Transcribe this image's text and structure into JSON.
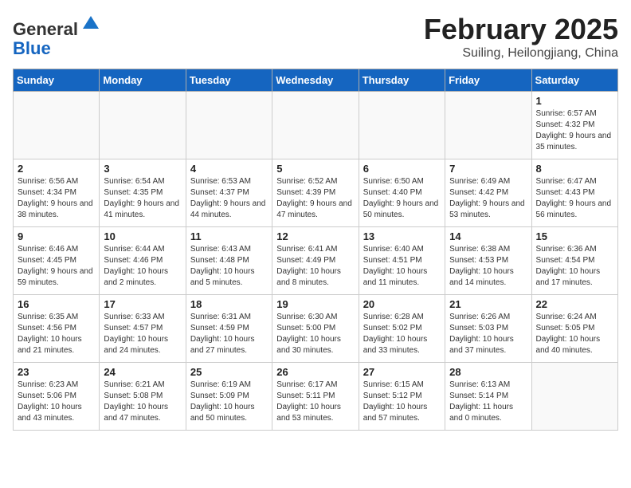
{
  "header": {
    "logo_general": "General",
    "logo_blue": "Blue",
    "month_title": "February 2025",
    "location": "Suiling, Heilongjiang, China"
  },
  "weekdays": [
    "Sunday",
    "Monday",
    "Tuesday",
    "Wednesday",
    "Thursday",
    "Friday",
    "Saturday"
  ],
  "weeks": [
    [
      {
        "day": "",
        "info": ""
      },
      {
        "day": "",
        "info": ""
      },
      {
        "day": "",
        "info": ""
      },
      {
        "day": "",
        "info": ""
      },
      {
        "day": "",
        "info": ""
      },
      {
        "day": "",
        "info": ""
      },
      {
        "day": "1",
        "info": "Sunrise: 6:57 AM\nSunset: 4:32 PM\nDaylight: 9 hours and 35 minutes."
      }
    ],
    [
      {
        "day": "2",
        "info": "Sunrise: 6:56 AM\nSunset: 4:34 PM\nDaylight: 9 hours and 38 minutes."
      },
      {
        "day": "3",
        "info": "Sunrise: 6:54 AM\nSunset: 4:35 PM\nDaylight: 9 hours and 41 minutes."
      },
      {
        "day": "4",
        "info": "Sunrise: 6:53 AM\nSunset: 4:37 PM\nDaylight: 9 hours and 44 minutes."
      },
      {
        "day": "5",
        "info": "Sunrise: 6:52 AM\nSunset: 4:39 PM\nDaylight: 9 hours and 47 minutes."
      },
      {
        "day": "6",
        "info": "Sunrise: 6:50 AM\nSunset: 4:40 PM\nDaylight: 9 hours and 50 minutes."
      },
      {
        "day": "7",
        "info": "Sunrise: 6:49 AM\nSunset: 4:42 PM\nDaylight: 9 hours and 53 minutes."
      },
      {
        "day": "8",
        "info": "Sunrise: 6:47 AM\nSunset: 4:43 PM\nDaylight: 9 hours and 56 minutes."
      }
    ],
    [
      {
        "day": "9",
        "info": "Sunrise: 6:46 AM\nSunset: 4:45 PM\nDaylight: 9 hours and 59 minutes."
      },
      {
        "day": "10",
        "info": "Sunrise: 6:44 AM\nSunset: 4:46 PM\nDaylight: 10 hours and 2 minutes."
      },
      {
        "day": "11",
        "info": "Sunrise: 6:43 AM\nSunset: 4:48 PM\nDaylight: 10 hours and 5 minutes."
      },
      {
        "day": "12",
        "info": "Sunrise: 6:41 AM\nSunset: 4:49 PM\nDaylight: 10 hours and 8 minutes."
      },
      {
        "day": "13",
        "info": "Sunrise: 6:40 AM\nSunset: 4:51 PM\nDaylight: 10 hours and 11 minutes."
      },
      {
        "day": "14",
        "info": "Sunrise: 6:38 AM\nSunset: 4:53 PM\nDaylight: 10 hours and 14 minutes."
      },
      {
        "day": "15",
        "info": "Sunrise: 6:36 AM\nSunset: 4:54 PM\nDaylight: 10 hours and 17 minutes."
      }
    ],
    [
      {
        "day": "16",
        "info": "Sunrise: 6:35 AM\nSunset: 4:56 PM\nDaylight: 10 hours and 21 minutes."
      },
      {
        "day": "17",
        "info": "Sunrise: 6:33 AM\nSunset: 4:57 PM\nDaylight: 10 hours and 24 minutes."
      },
      {
        "day": "18",
        "info": "Sunrise: 6:31 AM\nSunset: 4:59 PM\nDaylight: 10 hours and 27 minutes."
      },
      {
        "day": "19",
        "info": "Sunrise: 6:30 AM\nSunset: 5:00 PM\nDaylight: 10 hours and 30 minutes."
      },
      {
        "day": "20",
        "info": "Sunrise: 6:28 AM\nSunset: 5:02 PM\nDaylight: 10 hours and 33 minutes."
      },
      {
        "day": "21",
        "info": "Sunrise: 6:26 AM\nSunset: 5:03 PM\nDaylight: 10 hours and 37 minutes."
      },
      {
        "day": "22",
        "info": "Sunrise: 6:24 AM\nSunset: 5:05 PM\nDaylight: 10 hours and 40 minutes."
      }
    ],
    [
      {
        "day": "23",
        "info": "Sunrise: 6:23 AM\nSunset: 5:06 PM\nDaylight: 10 hours and 43 minutes."
      },
      {
        "day": "24",
        "info": "Sunrise: 6:21 AM\nSunset: 5:08 PM\nDaylight: 10 hours and 47 minutes."
      },
      {
        "day": "25",
        "info": "Sunrise: 6:19 AM\nSunset: 5:09 PM\nDaylight: 10 hours and 50 minutes."
      },
      {
        "day": "26",
        "info": "Sunrise: 6:17 AM\nSunset: 5:11 PM\nDaylight: 10 hours and 53 minutes."
      },
      {
        "day": "27",
        "info": "Sunrise: 6:15 AM\nSunset: 5:12 PM\nDaylight: 10 hours and 57 minutes."
      },
      {
        "day": "28",
        "info": "Sunrise: 6:13 AM\nSunset: 5:14 PM\nDaylight: 11 hours and 0 minutes."
      },
      {
        "day": "",
        "info": ""
      }
    ]
  ]
}
